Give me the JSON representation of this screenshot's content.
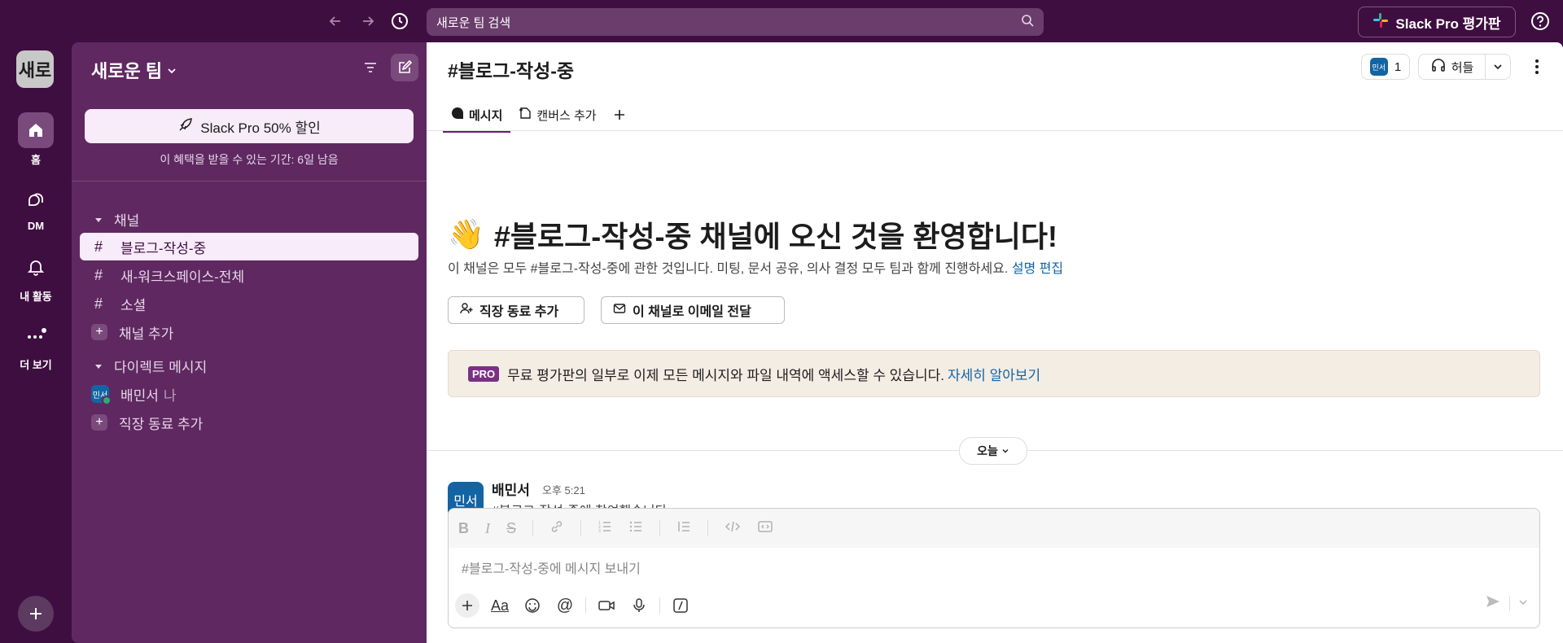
{
  "topbar": {
    "search_placeholder": "새로운 팀 검색",
    "pro_label": "Slack Pro 평가판"
  },
  "rail": {
    "workspace_initials": "새로",
    "items": [
      {
        "label": "홈",
        "icon": "home-icon"
      },
      {
        "label": "DM",
        "icon": "dm-icon"
      },
      {
        "label": "내 활동",
        "icon": "bell-icon"
      },
      {
        "label": "더 보기",
        "icon": "more-icon"
      }
    ]
  },
  "sidebar": {
    "workspace_name": "새로운 팀",
    "promo_button": "Slack Pro 50% 할인",
    "promo_sub": "이 혜택을 받을 수 있는 기간: 6일 남음",
    "channels_header": "채널",
    "channels": [
      "블로그-작성-중",
      "새-워크스페이스-전체",
      "소셜"
    ],
    "add_channel": "채널 추가",
    "dm_header": "다이렉트 메시지",
    "dm_user": "배민서",
    "dm_user_initials": "민서",
    "dm_me": "나",
    "add_coworker": "직장 동료 추가"
  },
  "main": {
    "channel_title": "#블로그-작성-중",
    "member_initials": "민서",
    "member_count": "1",
    "huddle_label": "허들",
    "tabs": [
      "메시지",
      "캔버스 추가"
    ],
    "welcome_emoji": "👋",
    "welcome_title": "#블로그-작성-중 채널에 오신 것을 환영합니다!",
    "welcome_desc": "이 채널은 모두 #블로그-작성-중에 관한 것입니다. 미팅, 문서 공유, 의사 결정 모두 팀과 함께 진행하세요.",
    "edit_desc_link": "설명 편집",
    "btn_add_coworker": "직장 동료 추가",
    "btn_email": "이 채널로 이메일 전달",
    "pro_tag": "PRO",
    "pro_banner_text": "무료 평가판의 일부로 이제 모든 메시지와 파일 내역에 액세스할 수 있습니다.",
    "pro_banner_link": "자세히 알아보기",
    "day_label": "오늘",
    "message": {
      "avatar_initials": "민서",
      "author": "배민서",
      "time": "오후 5:21",
      "text": "#블로그-작성-중에 참여했습니다"
    },
    "composer_placeholder": "#블로그-작성-중에 메시지 보내기"
  },
  "colors": {
    "aubergine": "#3f0e40",
    "sidebar": "#5f2861",
    "link": "#1264a3",
    "pro_tag": "#7c3085"
  }
}
